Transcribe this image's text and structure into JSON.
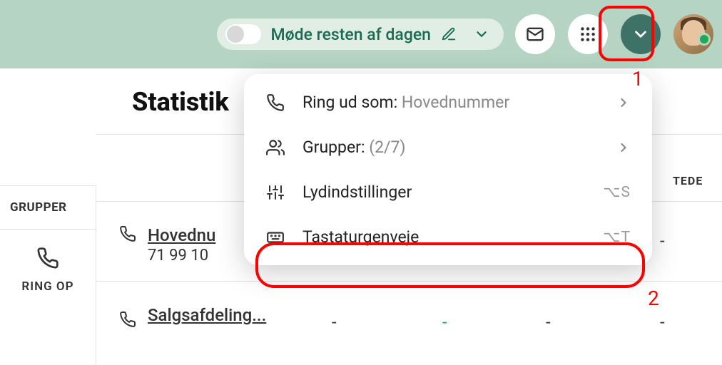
{
  "header": {
    "status_text": "Møde resten af dagen"
  },
  "page": {
    "title": "Statistik"
  },
  "sidebar": {
    "section_label": "GRUPPER",
    "ring_label": "RING OP"
  },
  "columns": {
    "col5": "TEDE"
  },
  "groups": [
    {
      "name": "Hovednu",
      "phone": "71 99 10",
      "dash": "-"
    },
    {
      "name": "Salgsafdeling...",
      "d1": "-",
      "d2": "-",
      "d3": "-",
      "d4": "-"
    }
  ],
  "dropdown": {
    "items": [
      {
        "label": "Ring ud som:",
        "value": "Hovednummer",
        "has_chevron": true
      },
      {
        "label": "Grupper:",
        "value": "(2/7)",
        "has_chevron": true
      },
      {
        "label": "Lydindstillinger",
        "shortcut": "⌥S"
      },
      {
        "label": "Tastaturgenveje",
        "shortcut": "⌥T"
      }
    ]
  },
  "annotations": {
    "num1": "1",
    "num2": "2"
  }
}
